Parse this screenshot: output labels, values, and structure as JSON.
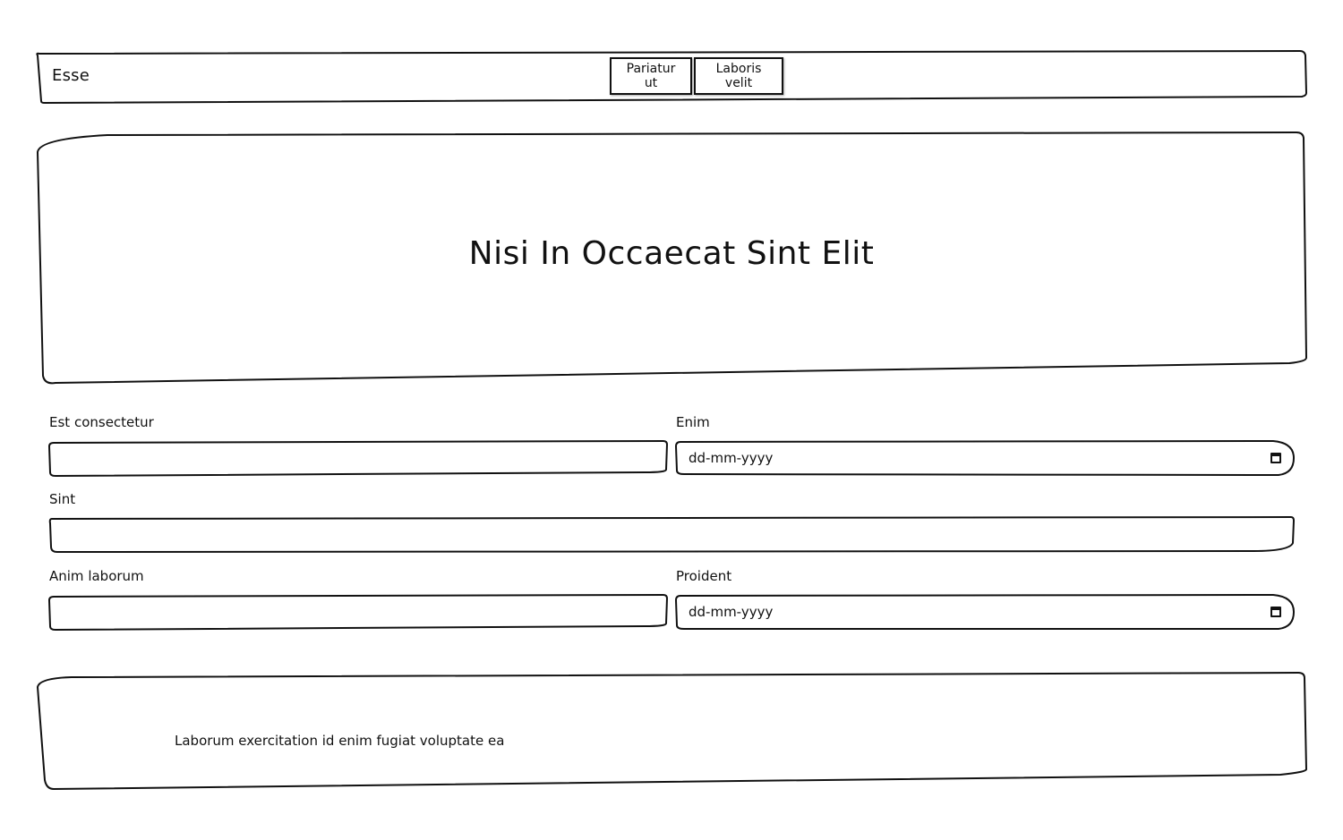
{
  "navbar": {
    "brand": "Esse",
    "buttons": [
      "Pariatur ut",
      "Laboris velit"
    ]
  },
  "hero": {
    "title": "Nisi In Occaecat Sint Elit"
  },
  "form": {
    "fields": [
      {
        "label": "Est consectetur",
        "type": "text",
        "value": ""
      },
      {
        "label": "Enim",
        "type": "date",
        "placeholder": "dd-mm-yyyy"
      },
      {
        "label": "Sint",
        "type": "text",
        "value": ""
      },
      {
        "label": "Anim laborum",
        "type": "text",
        "value": ""
      },
      {
        "label": "Proident",
        "type": "date",
        "placeholder": "dd-mm-yyyy"
      }
    ]
  },
  "footer": {
    "text": "Laborum exercitation id enim fugiat voluptate ea"
  },
  "icons": {
    "date_picker": "calendar-icon"
  }
}
